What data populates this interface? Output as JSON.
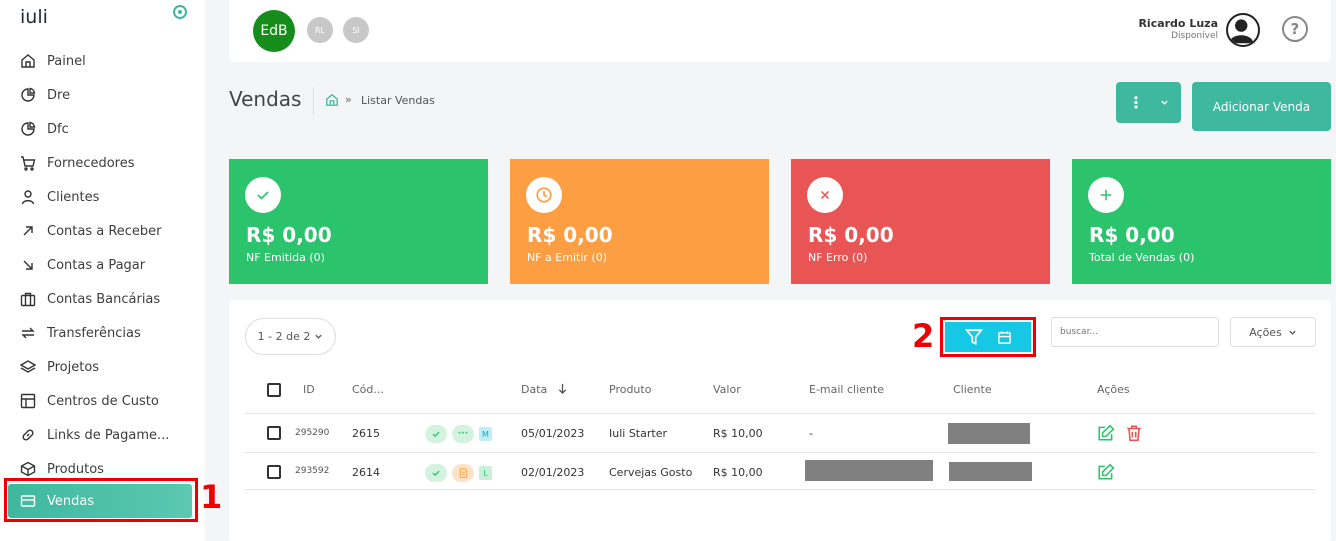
{
  "app": {
    "logo": "iuli"
  },
  "sidebar": {
    "items": [
      {
        "label": "Painel",
        "icon": "home-icon"
      },
      {
        "label": "Dre",
        "icon": "pie-chart-icon"
      },
      {
        "label": "Dfc",
        "icon": "pie-chart-icon"
      },
      {
        "label": "Fornecedores",
        "icon": "cart-icon"
      },
      {
        "label": "Clientes",
        "icon": "user-icon"
      },
      {
        "label": "Contas a Receber",
        "icon": "arrow-up-right-icon"
      },
      {
        "label": "Contas a Pagar",
        "icon": "arrow-down-right-icon"
      },
      {
        "label": "Contas Bancárias",
        "icon": "briefcase-icon"
      },
      {
        "label": "Transferências",
        "icon": "transfer-icon"
      },
      {
        "label": "Projetos",
        "icon": "layers-icon"
      },
      {
        "label": "Centros de Custo",
        "icon": "layout-icon"
      },
      {
        "label": "Links de Pagame...",
        "icon": "link-icon"
      },
      {
        "label": "Produtos",
        "icon": "box-icon"
      },
      {
        "label": "Vendas",
        "icon": "credit-card-icon"
      }
    ],
    "active": "Vendas"
  },
  "annotations": {
    "label1": "1",
    "label2": "2",
    "color": "#ee0000"
  },
  "topbar": {
    "company_avatar": "EdB",
    "small_avatars": [
      "RL",
      "SI"
    ],
    "user_name": "Ricardo Luza",
    "user_status": "Disponível",
    "help": "?"
  },
  "page": {
    "title": "Vendas",
    "breadcrumb_sep": "»",
    "breadcrumb_current": "Listar Vendas",
    "add_button": "Adicionar Venda",
    "more_button": "⋮"
  },
  "cards": [
    {
      "amount": "R$ 0,00",
      "label": "NF Emitida (0)",
      "color": "#2bc46c",
      "icon": "check-icon"
    },
    {
      "amount": "R$ 0,00",
      "label": "NF a Emitir (0)",
      "color": "#fd9e42",
      "icon": "clock-icon"
    },
    {
      "amount": "R$ 0,00",
      "label": "NF Erro (0)",
      "color": "#e95454",
      "icon": "x-icon"
    },
    {
      "amount": "R$ 0,00",
      "label": "Total de Vendas (0)",
      "color": "#2bc46c",
      "icon": "plus-icon"
    }
  ],
  "table": {
    "pager": "1 - 2 de 2",
    "search_placeholder": "buscar...",
    "actions_button": "Ações",
    "headers": [
      "ID",
      "Cód...",
      "Data",
      "Produto",
      "Valor",
      "E-mail cliente",
      "Cliente",
      "Ações"
    ],
    "rows": [
      {
        "id": "295290",
        "cod": "2615",
        "data": "05/01/2023",
        "produto": "Iuli Starter",
        "valor": "R$ 10,00",
        "email": "-",
        "tag": "M"
      },
      {
        "id": "293592",
        "cod": "2614",
        "data": "02/01/2023",
        "produto": "Cervejas Gosto",
        "valor": "R$ 10,00",
        "email": "",
        "tag": "L"
      }
    ]
  }
}
